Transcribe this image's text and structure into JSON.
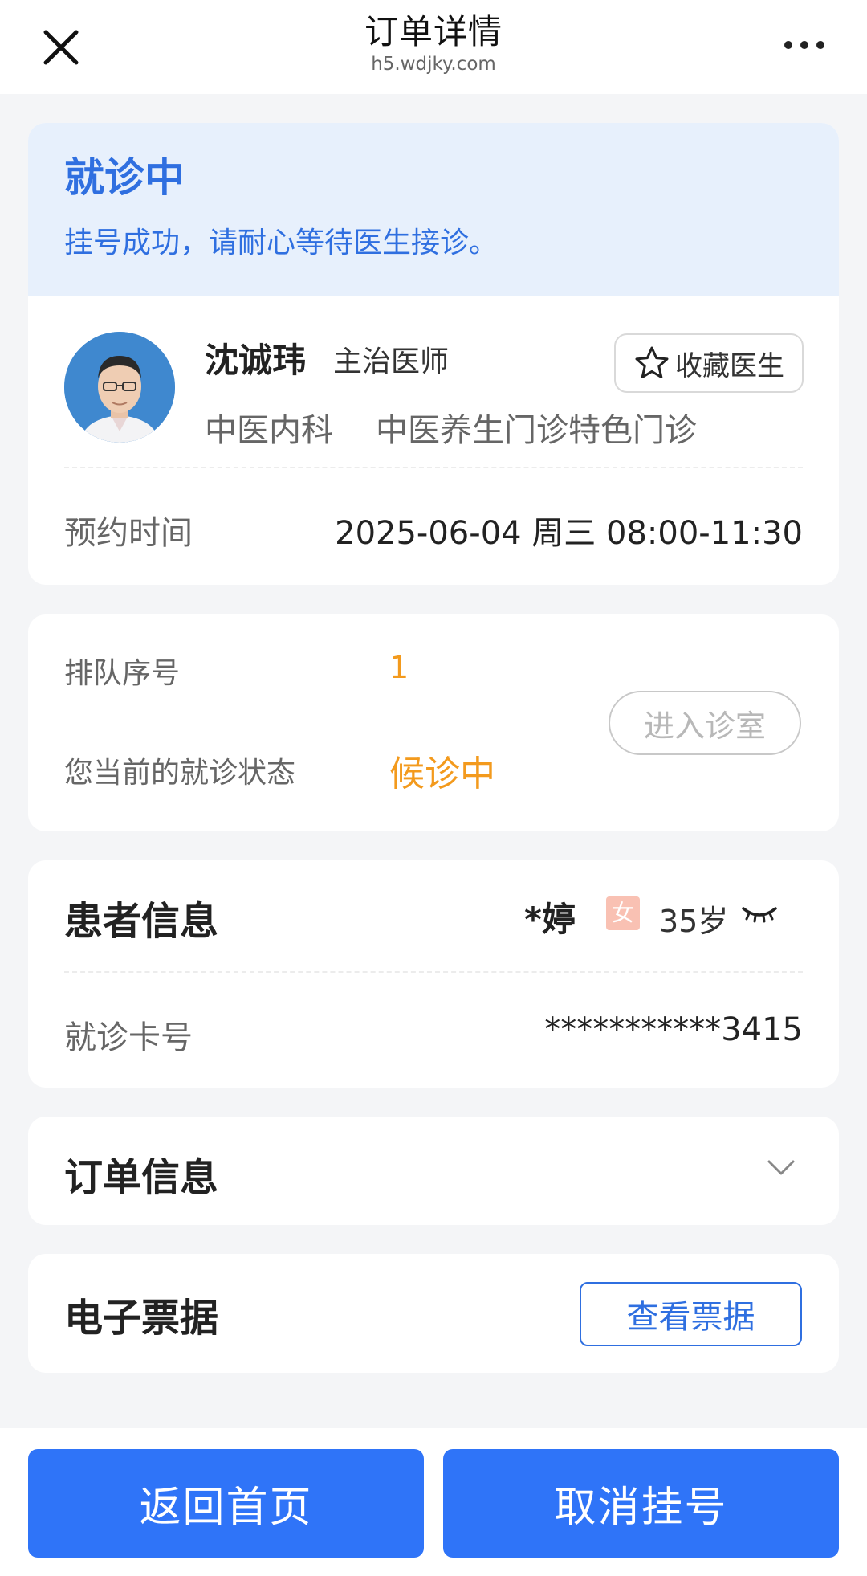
{
  "header": {
    "title": "订单详情",
    "url": "h5.wdjky.com"
  },
  "status": {
    "title": "就诊中",
    "message": "挂号成功，请耐心等待医生接诊。"
  },
  "doctor": {
    "name": "沈诚玮",
    "title": "主治医师",
    "favorite_label": "收藏医生",
    "department": "中医内科",
    "clinic": "中医养生门诊特色门诊"
  },
  "appointment": {
    "label": "预约时间",
    "value": "2025-06-04 周三 08:00-11:30"
  },
  "queue": {
    "number_label": "排队序号",
    "number_value": "1",
    "status_label": "您当前的就诊状态",
    "status_value": "候诊中",
    "enter_label": "进入诊室"
  },
  "patient": {
    "section_title": "患者信息",
    "name": "*婷",
    "sex": "女",
    "age": "35岁",
    "card_label": "就诊卡号",
    "card_value": "***********3415"
  },
  "order": {
    "section_title": "订单信息"
  },
  "receipt": {
    "section_title": "电子票据",
    "button_label": "查看票据"
  },
  "footer": {
    "home_label": "返回首页",
    "cancel_label": "取消挂号"
  },
  "icons": {
    "close": "close-icon",
    "more": "more-dots-icon",
    "star": "star-icon",
    "eye": "eye-closed-icon",
    "chevron": "chevron-down-icon"
  },
  "colors": {
    "accent": "#2f74f8",
    "status_blue": "#2f6fe0",
    "status_bg": "#e7f0fc",
    "warning": "#f39a1d",
    "female_badge": "#f9c1b3"
  }
}
